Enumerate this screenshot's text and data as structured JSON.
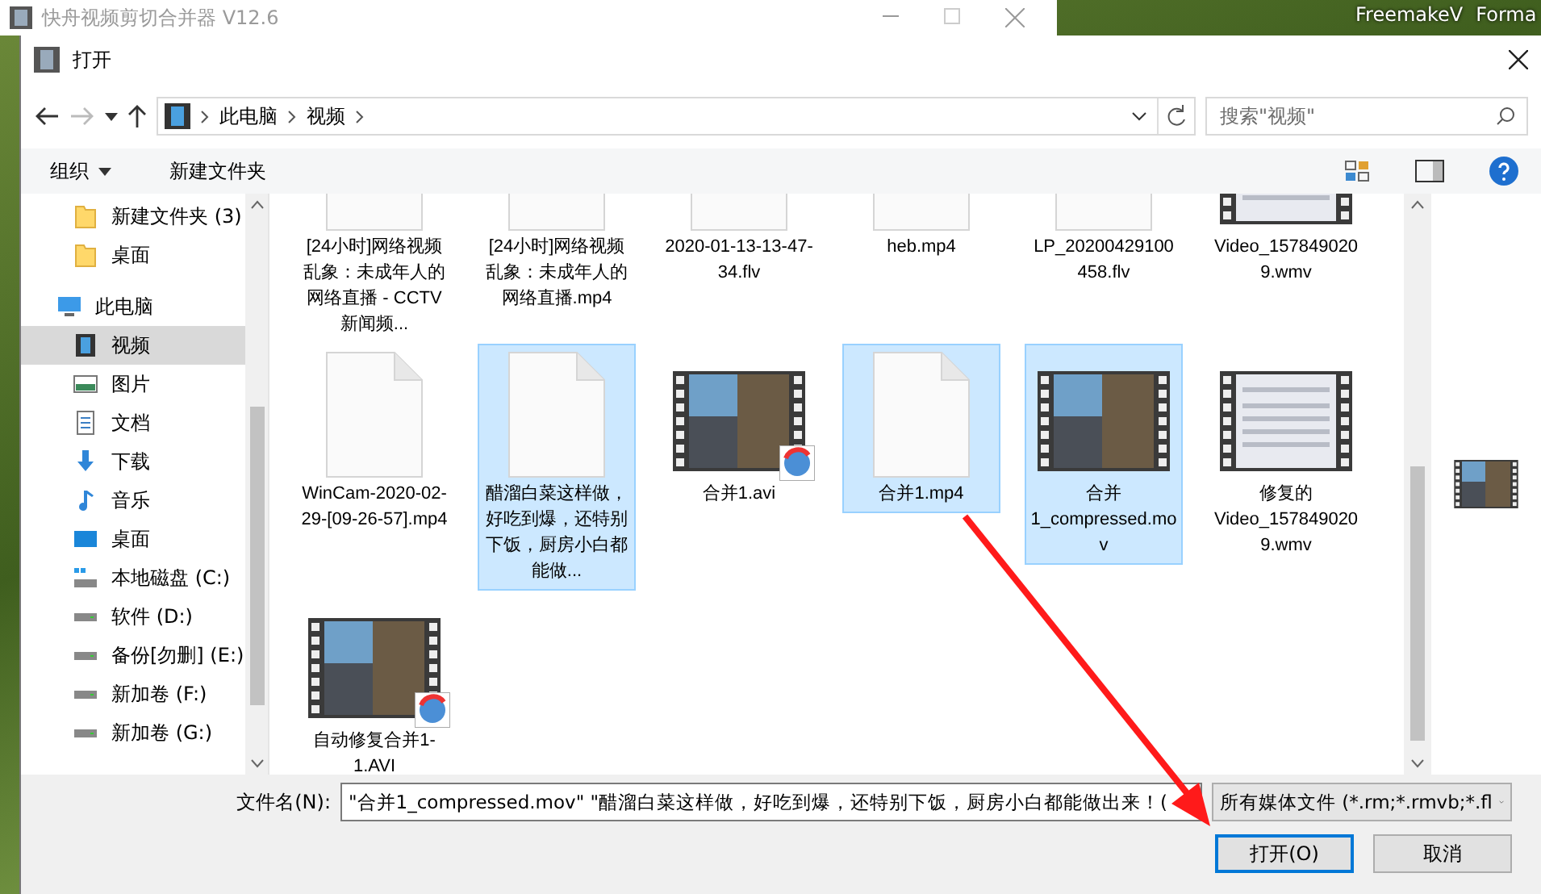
{
  "background_window": {
    "title": "快舟视频剪切合并器 V12.6"
  },
  "desktop_labels": [
    "FreemakeV",
    "Forma"
  ],
  "dialog": {
    "title": "打开"
  },
  "address_bar": {
    "path": [
      "此电脑",
      "视频"
    ],
    "search_placeholder": "搜索\"视频\""
  },
  "toolbar": {
    "organize": "组织",
    "new_folder": "新建文件夹"
  },
  "sidebar": {
    "quick_access_items": [
      {
        "label": "新建文件夹 (3)",
        "kind": "folder",
        "selected": false
      },
      {
        "label": "桌面",
        "kind": "folder",
        "selected": false
      }
    ],
    "tree": [
      {
        "label": "此电脑",
        "kind": "pc",
        "selected": false,
        "children": [
          {
            "label": "视频",
            "kind": "video",
            "selected": true
          },
          {
            "label": "图片",
            "kind": "pictures",
            "selected": false
          },
          {
            "label": "文档",
            "kind": "documents",
            "selected": false
          },
          {
            "label": "下载",
            "kind": "downloads",
            "selected": false
          },
          {
            "label": "音乐",
            "kind": "music",
            "selected": false
          },
          {
            "label": "桌面",
            "kind": "desktop",
            "selected": false
          },
          {
            "label": "本地磁盘 (C:)",
            "kind": "systemdisk",
            "selected": false
          },
          {
            "label": "软件 (D:)",
            "kind": "disk",
            "selected": false
          },
          {
            "label": "备份[勿删] (E:)",
            "kind": "disk",
            "selected": false
          },
          {
            "label": "新加卷 (F:)",
            "kind": "disk",
            "selected": false
          },
          {
            "label": "新加卷 (G:)",
            "kind": "disk",
            "selected": false
          }
        ]
      }
    ]
  },
  "files": [
    {
      "name": "[24小时]网络视频乱象：未成年人的网络直播 - CCTV 新闻频...",
      "kind": "blank",
      "selected": false
    },
    {
      "name": "[24小时]网络视频乱象：未成年人的网络直播.mp4",
      "kind": "blank",
      "selected": false
    },
    {
      "name": "2020-01-13-13-47-34.flv",
      "kind": "blank",
      "selected": false
    },
    {
      "name": "heb.mp4",
      "kind": "blank",
      "selected": false
    },
    {
      "name": "LP_20200429100458.flv",
      "kind": "blank",
      "selected": false
    },
    {
      "name": "Video_1578490209.wmv",
      "kind": "app-video",
      "selected": false
    },
    {
      "name": "WinCam-2020-02-29-[09-26-57].mp4",
      "kind": "blank",
      "selected": false
    },
    {
      "name": "醋溜白菜这样做，好吃到爆，还特别下饭，厨房小白都能做...",
      "kind": "blank",
      "selected": true
    },
    {
      "name": "合并1.avi",
      "kind": "video-badge",
      "selected": false
    },
    {
      "name": "合并1.mp4",
      "kind": "blank",
      "selected": true
    },
    {
      "name": "合并1_compressed.mov",
      "kind": "video",
      "selected": true
    },
    {
      "name": "修复的Video_1578490209.wmv",
      "kind": "app-video",
      "selected": false
    },
    {
      "name": "自动修复合并1-1.AVI",
      "kind": "video-badge",
      "selected": false
    }
  ],
  "footer": {
    "filename_label": "文件名(N):",
    "filename_value": "\"合并1_compressed.mov\" \"醋溜白菜这样做，好吃到爆，还特别下饭，厨房小白都能做出来！(",
    "filter": "所有媒体文件 (*.rm;*.rmvb;*.fl",
    "open_button": "打开(O)",
    "cancel_button": "取消"
  }
}
